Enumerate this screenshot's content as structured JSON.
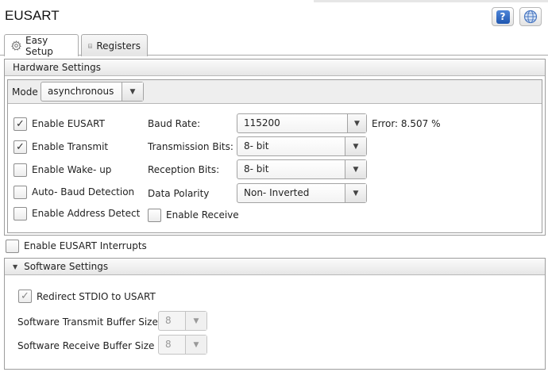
{
  "header": {
    "title": "EUSART",
    "help_label": "?",
    "icons": {
      "help": "help-icon",
      "globe": "globe-icon"
    }
  },
  "tabs": [
    {
      "label": "Easy Setup",
      "icon": "gear-icon",
      "active": true
    },
    {
      "label": "Registers",
      "icon": "table-icon",
      "active": false
    }
  ],
  "hardware": {
    "section_title": "Hardware Settings",
    "mode_label": "Mode",
    "mode_value": "asynchronous",
    "checkboxes": {
      "enable_eusart": {
        "label": "Enable EUSART",
        "checked": true
      },
      "enable_transmit": {
        "label": "Enable Transmit",
        "checked": true
      },
      "enable_wakeup": {
        "label": "Enable Wake- up",
        "checked": false
      },
      "auto_baud": {
        "label": "Auto- Baud Detection",
        "checked": false
      },
      "enable_address_detect": {
        "label": "Enable Address Detect",
        "checked": false
      },
      "enable_receive": {
        "label": "Enable Receive",
        "checked": false
      }
    },
    "baud_rate": {
      "label": "Baud Rate:",
      "value": "115200",
      "error_text": "Error: 8.507 %"
    },
    "transmission_bits": {
      "label": "Transmission Bits:",
      "value": "8- bit"
    },
    "reception_bits": {
      "label": "Reception Bits:",
      "value": "8- bit"
    },
    "data_polarity": {
      "label": "Data Polarity",
      "value": "Non- Inverted"
    }
  },
  "interrupts": {
    "label": "Enable EUSART Interrupts",
    "checked": false
  },
  "software": {
    "section_title": "Software Settings",
    "redirect_stdio": {
      "label": "Redirect STDIO to USART",
      "checked": true
    },
    "tx_buffer": {
      "label": "Software Transmit Buffer Size",
      "value": "8"
    },
    "rx_buffer": {
      "label": "Software Receive Buffer Size",
      "value": "8"
    }
  },
  "glyphs": {
    "check": "✓",
    "dropdown_arrow": "▼",
    "collapse_arrow": "▼"
  }
}
